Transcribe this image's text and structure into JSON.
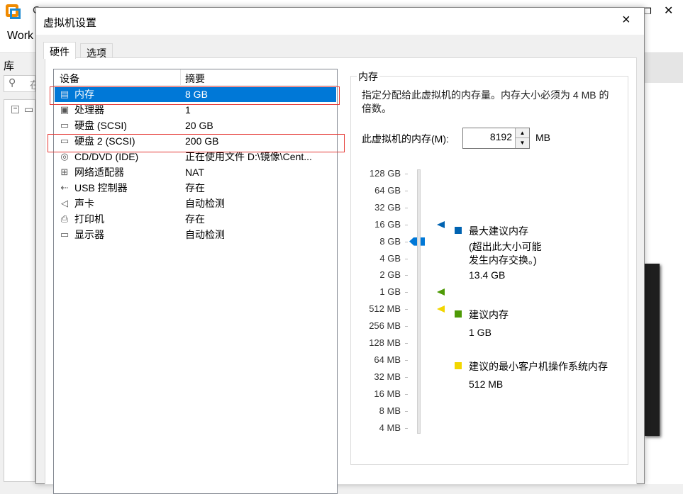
{
  "background_app": {
    "title_fragment": "C",
    "toolbar_fragment": "Work",
    "library_label": "库",
    "search_fragment": "在"
  },
  "dialog": {
    "title": "虚拟机设置",
    "close": "×"
  },
  "tabs": [
    {
      "label": "硬件",
      "active": true
    },
    {
      "label": "选项",
      "active": false
    }
  ],
  "device_list": {
    "headers": [
      "设备",
      "摘要"
    ],
    "rows": [
      {
        "icon": "memory-icon",
        "glyph": "▤",
        "device": "内存",
        "summary": "8 GB",
        "selected": true,
        "highlighted": true
      },
      {
        "icon": "processor-icon",
        "glyph": "▣",
        "device": "处理器",
        "summary": "1"
      },
      {
        "icon": "hard-disk-icon",
        "glyph": "▭",
        "device": "硬盘 (SCSI)",
        "summary": "20 GB"
      },
      {
        "icon": "hard-disk-icon",
        "glyph": "▭",
        "device": "硬盘 2 (SCSI)",
        "summary": "200 GB",
        "highlighted": true
      },
      {
        "icon": "cd-dvd-icon",
        "glyph": "◎",
        "device": "CD/DVD (IDE)",
        "summary": "正在使用文件 D:\\镜像\\Cent..."
      },
      {
        "icon": "network-adapter-icon",
        "glyph": "⊞",
        "device": "网络适配器",
        "summary": "NAT"
      },
      {
        "icon": "usb-icon",
        "glyph": "⇠",
        "device": "USB 控制器",
        "summary": "存在"
      },
      {
        "icon": "speaker-icon",
        "glyph": "◁",
        "device": "声卡",
        "summary": "自动检测"
      },
      {
        "icon": "printer-icon",
        "glyph": "⎙",
        "device": "打印机",
        "summary": "存在"
      },
      {
        "icon": "monitor-icon",
        "glyph": "▭",
        "device": "显示器",
        "summary": "自动检测"
      }
    ]
  },
  "memory": {
    "group_title": "内存",
    "description": "指定分配给此虚拟机的内存量。内存大小必须为 4 MB 的倍数。",
    "field_label": "此虚拟机的内存(M):",
    "value": "8192",
    "unit": "MB",
    "scale": [
      "128 GB",
      "64 GB",
      "32 GB",
      "16 GB",
      "8 GB",
      "4 GB",
      "2 GB",
      "1 GB",
      "512 MB",
      "256 MB",
      "128 MB",
      "64 MB",
      "32 MB",
      "16 MB",
      "8 MB",
      "4 MB"
    ],
    "slider_value": "8 GB",
    "legend": [
      {
        "color": "#0063b1",
        "label": "最大建议内存",
        "note": "(超出此大小可能\n发生内存交换。)",
        "value": "13.4 GB",
        "level": "16 GB"
      },
      {
        "color": "#4e9a06",
        "label": "建议内存",
        "value": "1 GB",
        "level": "1 GB"
      },
      {
        "color": "#f2d600",
        "label": "建议的最小客户机操作系统内存",
        "value": "512 MB",
        "level": "512 MB"
      }
    ],
    "thumb_color": "#0078d7"
  }
}
